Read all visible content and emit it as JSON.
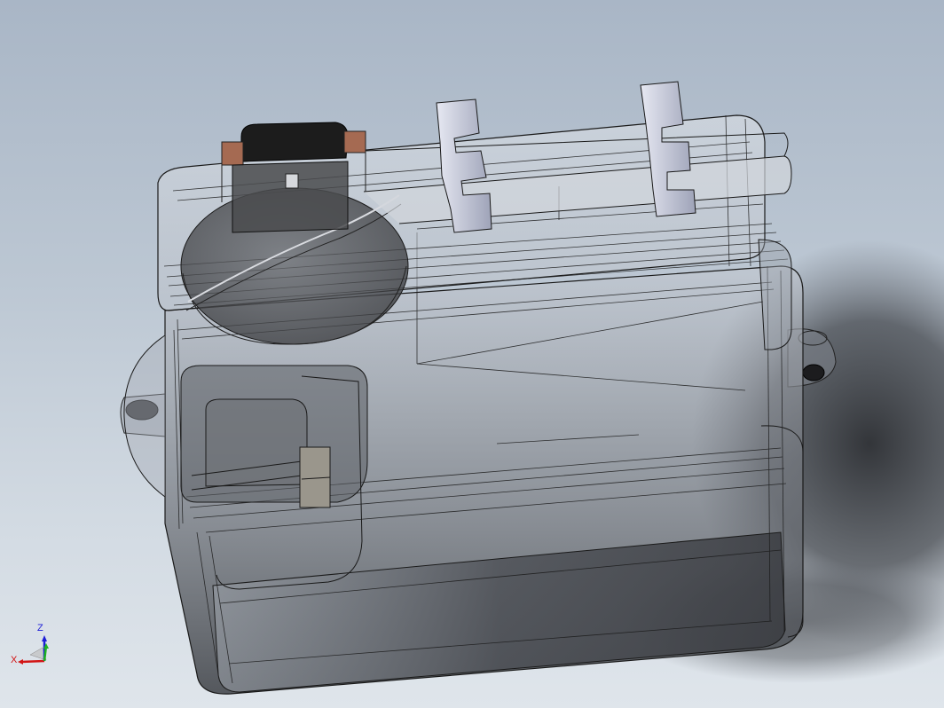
{
  "triad": {
    "x_label": "X",
    "z_label": "Z",
    "x_color": "#d21414",
    "y_color": "#1fb31f",
    "z_color": "#1d1dd6"
  },
  "model": {
    "display_mode": "shaded-with-edges-transparent",
    "body_color": "#c8cdd6",
    "edge_color": "#1a1a1a",
    "cap_color": "#1c1c1c",
    "clip_color": "#aeb3c8"
  }
}
